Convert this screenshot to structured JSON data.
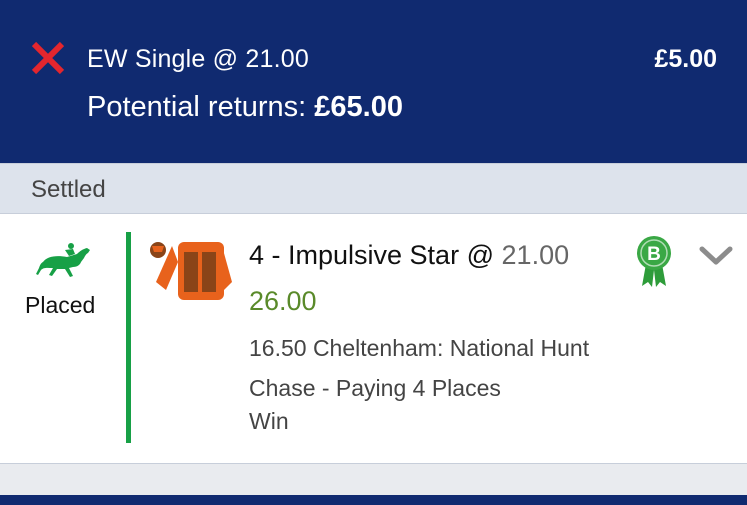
{
  "header": {
    "bet_type": "EW Single @ 21.00",
    "stake": "£5.00",
    "returns_label": "Potential returns:",
    "returns_value": "£65.00"
  },
  "section": {
    "label": "Settled"
  },
  "bet": {
    "status": "Placed",
    "selection": "4 - Impulsive Star",
    "at": "@",
    "price": "21.00",
    "boosted_price": "26.00",
    "event": "16.50 Cheltenham: National Hunt Chase - Paying 4 Places",
    "result": "Win",
    "badge_letter": "B"
  },
  "icons": {
    "close": "close-icon",
    "horse": "horse-racing-icon",
    "silks": "jockey-silks-icon",
    "badge": "boost-badge-icon",
    "expand": "chevron-down-icon"
  },
  "colors": {
    "header_bg": "#102a70",
    "close_red": "#e3262e",
    "success_green": "#17a046",
    "boosted_price": "#5a8a2a",
    "silks_orange": "#e8621c"
  }
}
